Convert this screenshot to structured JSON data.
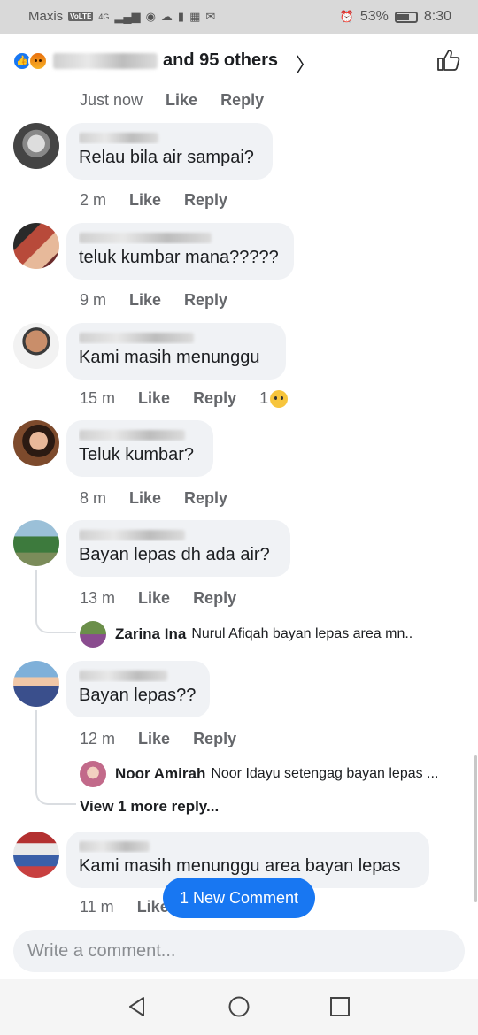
{
  "status_bar": {
    "carrier": "Maxis",
    "network_badges": [
      "VoLTE",
      "4G"
    ],
    "battery": "53%",
    "time": "8:30",
    "icons": [
      "signal-icon",
      "whatsapp-icon",
      "cloud-icon",
      "battery-small-icon",
      "calendar-icon",
      "mail-icon",
      "alarm-icon"
    ]
  },
  "reactions": {
    "names_suffix": "and 95 others",
    "icons": [
      "like-reaction-icon",
      "angry-reaction-icon"
    ]
  },
  "top_action": {
    "time": "Just now",
    "like": "Like",
    "reply": "Reply"
  },
  "comments": [
    {
      "text": "Relau bila air sampai?",
      "time": "2 m",
      "like": "Like",
      "reply": "Reply"
    },
    {
      "text": "teluk kumbar mana?????",
      "time": "9 m",
      "like": "Like",
      "reply": "Reply"
    },
    {
      "text": "Kami masih menunggu",
      "time": "15 m",
      "like": "Like",
      "reply": "Reply",
      "reaction_count": "1"
    },
    {
      "text": "Teluk kumbar?",
      "time": "8 m",
      "like": "Like",
      "reply": "Reply"
    },
    {
      "text": "Bayan lepas dh ada air?",
      "time": "13 m",
      "like": "Like",
      "reply": "Reply",
      "reply_preview": {
        "name": "Zarina Ina",
        "text": "Nurul Afiqah bayan lepas area mn.."
      }
    },
    {
      "text": "Bayan lepas??",
      "time": "12 m",
      "like": "Like",
      "reply": "Reply",
      "reply_preview": {
        "name": "Noor Amirah",
        "text": "Noor Idayu setengag bayan lepas ..."
      },
      "more_replies": "View 1 more reply..."
    },
    {
      "text": "Kami masih menunggu area bayan lepas",
      "time": "11 m",
      "like": "Like"
    }
  ],
  "new_comment_button": "1 New Comment",
  "composer": {
    "placeholder": "Write a comment..."
  },
  "navbar": {
    "icons": [
      "back-triangle-icon",
      "home-circle-icon",
      "recents-square-icon"
    ]
  }
}
